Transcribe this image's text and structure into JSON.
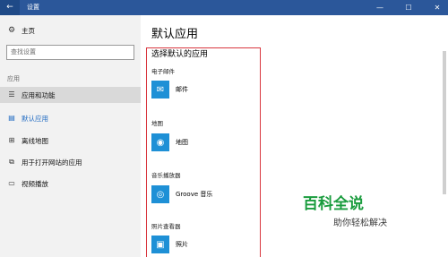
{
  "window": {
    "title": "设置",
    "back": "←",
    "min": "—",
    "max": "☐",
    "close": "✕"
  },
  "sidebar": {
    "home": {
      "icon": "gear-icon",
      "label": "主页"
    },
    "search_placeholder": "查找设置",
    "section": "应用",
    "items": [
      {
        "icon": "apps-list-icon",
        "label": "应用和功能"
      },
      {
        "icon": "default-apps-icon",
        "label": "默认应用"
      },
      {
        "icon": "offline-maps-icon",
        "label": "离线地图"
      },
      {
        "icon": "website-apps-icon",
        "label": "用于打开网站的应用"
      },
      {
        "icon": "video-playback-icon",
        "label": "视频播放"
      }
    ]
  },
  "main": {
    "title": "默认应用",
    "subtitle": "选择默认的应用",
    "categories": [
      {
        "label": "电子邮件",
        "app": "邮件",
        "icon": "mail-icon"
      },
      {
        "label": "地图",
        "app": "地图",
        "icon": "maps-icon"
      },
      {
        "label": "音乐播放器",
        "app": "Groove 音乐",
        "icon": "groove-music-icon"
      },
      {
        "label": "照片查看器",
        "app": "照片",
        "icon": "photos-icon"
      }
    ]
  },
  "watermark": {
    "big": "百科全说",
    "small": "助你轻松解决"
  }
}
